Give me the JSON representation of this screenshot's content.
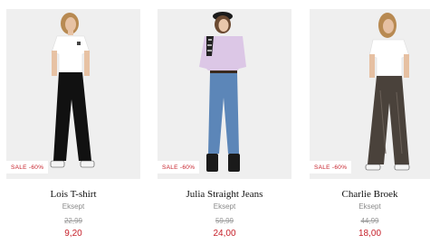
{
  "products": [
    {
      "name": "Lois T-shirt",
      "brand": "Eksept",
      "old_price": "22,99",
      "price": "9,20",
      "badge": "SALE -60%"
    },
    {
      "name": "Julia Straight Jeans",
      "brand": "Eksept",
      "old_price": "59,99",
      "price": "24,00",
      "badge": "SALE -60%"
    },
    {
      "name": "Charlie Broek",
      "brand": "Eksept",
      "old_price": "44,99",
      "price": "18,00",
      "badge": "SALE -60%"
    }
  ],
  "colors": {
    "sale": "#c6202a",
    "photo_bg": "#efefef",
    "muted_text": "#8a8a8a"
  }
}
